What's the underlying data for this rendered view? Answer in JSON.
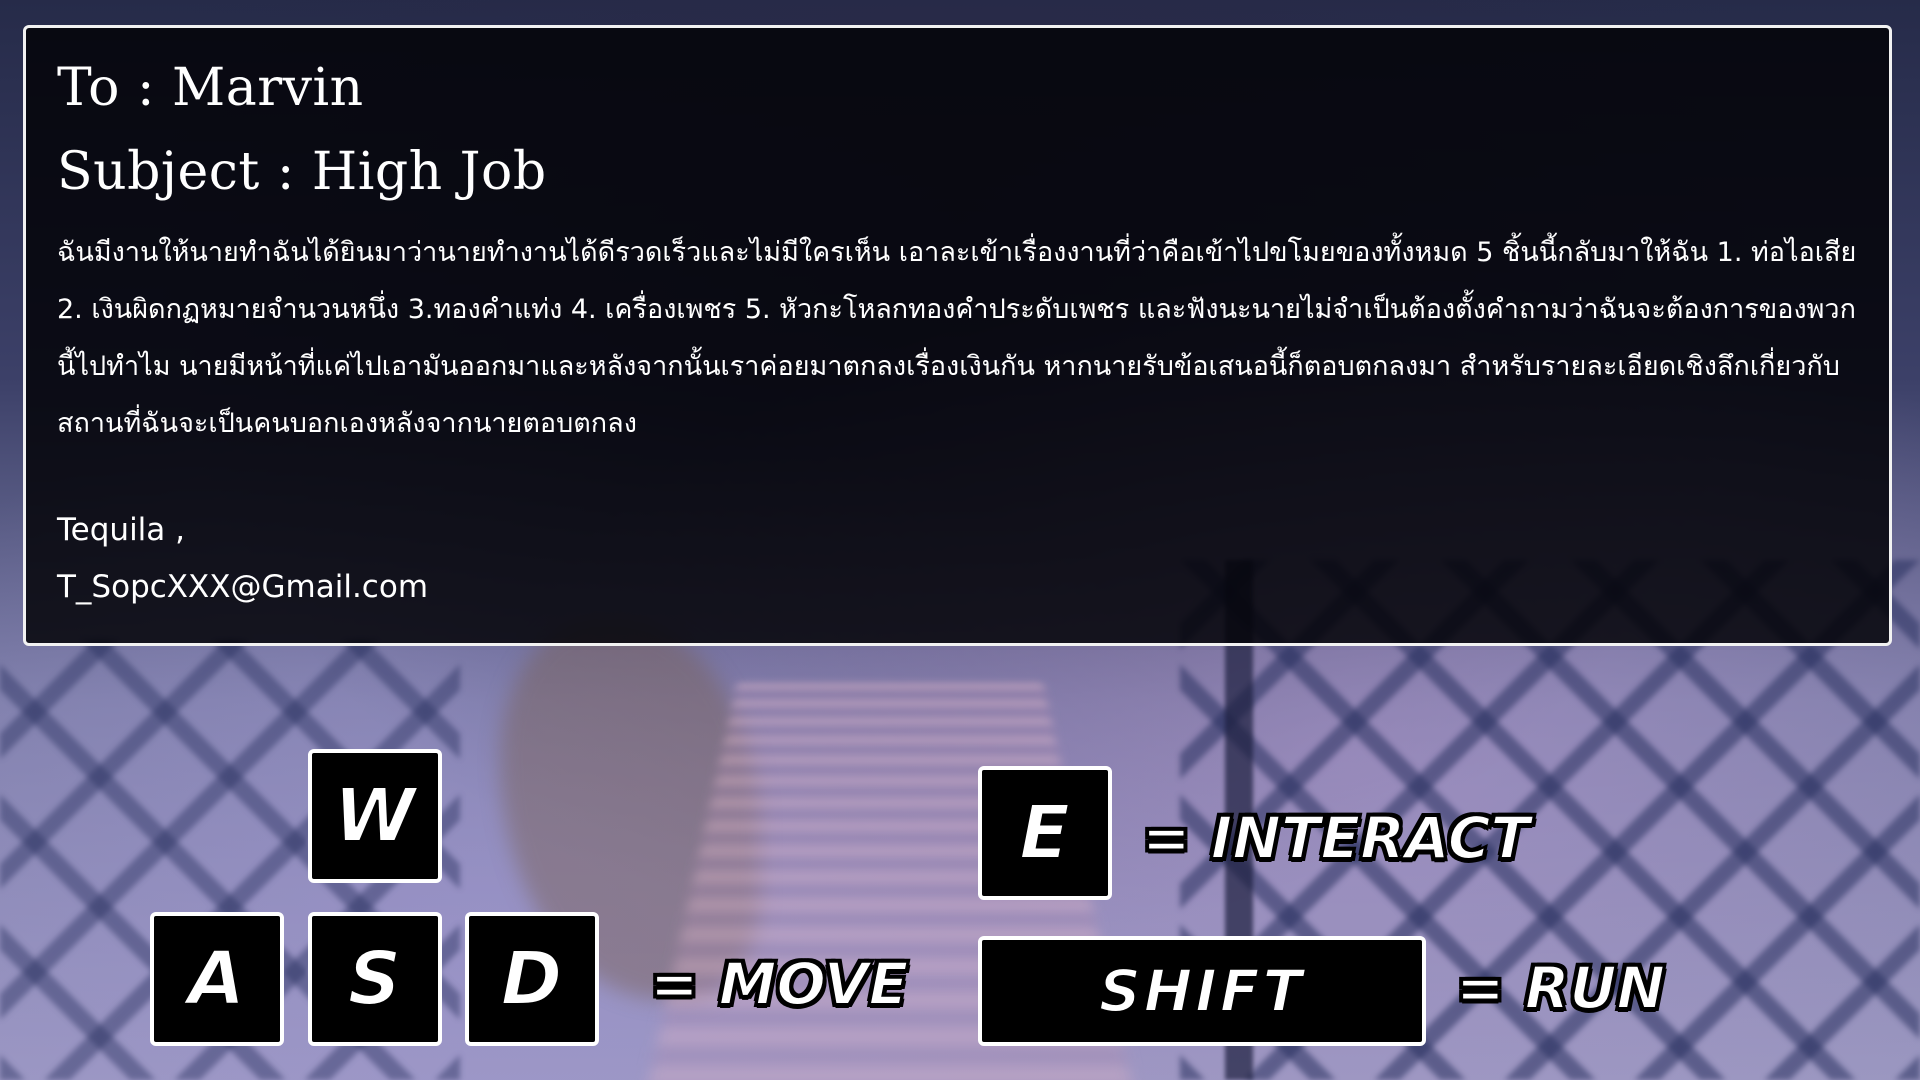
{
  "mail": {
    "to_line": "To : Marvin",
    "subject_line": "Subject : High Job",
    "body": "ฉันมีงานให้นายทำฉันได้ยินมาว่านายทำงานได้ดีรวดเร็วและไม่มีใครเห็น เอาละเข้าเรื่องงานที่ว่าคือเข้าไปขโมยของทั้งหมด 5 ชิ้นนี้กลับมาให้ฉัน 1. ท่อไอเสีย 2. เงินผิดกฏหมายจำนวนหนึ่ง 3.ทองคำแท่ง 4. เครื่องเพชร 5. หัวกะโหลกทองคำประดับเพชร และฟังนะนายไม่จำเป็นต้องตั้งคำถามว่าฉันจะต้องการของพวกนี้ไปทำไม นายมีหน้าที่แค่ไปเอามันออกมาและหลังจากนั้นเราค่อยมาตกลงเรื่องเงินกัน หากนายรับข้อเสนอนี้ก็ตอบตกลงมา สำหรับรายละเอียดเชิงลึกเกี่ยวกับสถานที่ฉันจะเป็นคนบอกเองหลังจากนายตอบตกลง",
    "sender_name": "Tequila ,",
    "sender_email": "T_SopcXXX@Gmail.com"
  },
  "controls": {
    "move_keys": [
      "W",
      "A",
      "S",
      "D"
    ],
    "move_label": "= MOVE",
    "interact_key": "E",
    "interact_label": "= INTERACT",
    "run_key": "SHIFT",
    "run_label": "= RUN"
  }
}
